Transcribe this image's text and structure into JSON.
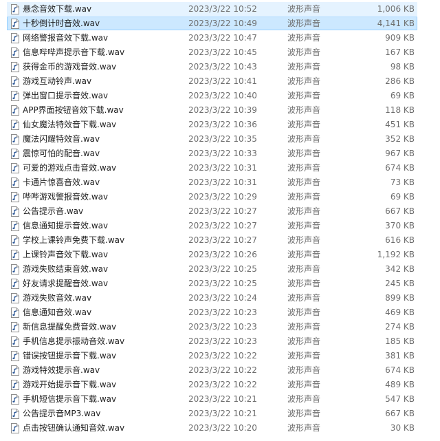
{
  "files": [
    {
      "name": "悬念音效下载.wav",
      "modified": "2023/3/22 10:52",
      "type": "波形声音",
      "size": "1,006 KB",
      "state": "hover"
    },
    {
      "name": "十秒倒计时音效.wav",
      "modified": "2023/3/22 10:49",
      "type": "波形声音",
      "size": "4,141 KB",
      "state": "selected"
    },
    {
      "name": "网络警报音效下载.wav",
      "modified": "2023/3/22 10:47",
      "type": "波形声音",
      "size": "909 KB",
      "state": ""
    },
    {
      "name": "信息哔哔声提示音下载.wav",
      "modified": "2023/3/22 10:45",
      "type": "波形声音",
      "size": "167 KB",
      "state": ""
    },
    {
      "name": "获得金币的游戏音效.wav",
      "modified": "2023/3/22 10:43",
      "type": "波形声音",
      "size": "98 KB",
      "state": ""
    },
    {
      "name": "游戏互动铃声.wav",
      "modified": "2023/3/22 10:41",
      "type": "波形声音",
      "size": "286 KB",
      "state": ""
    },
    {
      "name": "弹出窗口提示音效.wav",
      "modified": "2023/3/22 10:40",
      "type": "波形声音",
      "size": "69 KB",
      "state": ""
    },
    {
      "name": "APP界面按钮音效下载.wav",
      "modified": "2023/3/22 10:39",
      "type": "波形声音",
      "size": "118 KB",
      "state": ""
    },
    {
      "name": "仙女魔法特效音下载.wav",
      "modified": "2023/3/22 10:36",
      "type": "波形声音",
      "size": "451 KB",
      "state": ""
    },
    {
      "name": "魔法闪耀特效音.wav",
      "modified": "2023/3/22 10:35",
      "type": "波形声音",
      "size": "352 KB",
      "state": ""
    },
    {
      "name": "震惊可怕的配音.wav",
      "modified": "2023/3/22 10:33",
      "type": "波形声音",
      "size": "967 KB",
      "state": ""
    },
    {
      "name": "可爱的游戏点击音效.wav",
      "modified": "2023/3/22 10:31",
      "type": "波形声音",
      "size": "674 KB",
      "state": ""
    },
    {
      "name": "卡通片惊喜音效.wav",
      "modified": "2023/3/22 10:31",
      "type": "波形声音",
      "size": "73 KB",
      "state": ""
    },
    {
      "name": "哔哔游戏警报音效.wav",
      "modified": "2023/3/22 10:29",
      "type": "波形声音",
      "size": "69 KB",
      "state": ""
    },
    {
      "name": "公告提示音.wav",
      "modified": "2023/3/22 10:27",
      "type": "波形声音",
      "size": "667 KB",
      "state": ""
    },
    {
      "name": "信息通知提示音效.wav",
      "modified": "2023/3/22 10:27",
      "type": "波形声音",
      "size": "370 KB",
      "state": ""
    },
    {
      "name": "学校上课铃声免费下载.wav",
      "modified": "2023/3/22 10:27",
      "type": "波形声音",
      "size": "616 KB",
      "state": ""
    },
    {
      "name": "上课铃声音效下载.wav",
      "modified": "2023/3/22 10:26",
      "type": "波形声音",
      "size": "1,192 KB",
      "state": ""
    },
    {
      "name": "游戏失败结束音效.wav",
      "modified": "2023/3/22 10:25",
      "type": "波形声音",
      "size": "342 KB",
      "state": ""
    },
    {
      "name": "好友请求提醒音效.wav",
      "modified": "2023/3/22 10:25",
      "type": "波形声音",
      "size": "245 KB",
      "state": ""
    },
    {
      "name": "游戏失败音效.wav",
      "modified": "2023/3/22 10:24",
      "type": "波形声音",
      "size": "899 KB",
      "state": ""
    },
    {
      "name": "信息通知音效.wav",
      "modified": "2023/3/22 10:23",
      "type": "波形声音",
      "size": "469 KB",
      "state": ""
    },
    {
      "name": "新信息提醒免费音效.wav",
      "modified": "2023/3/22 10:23",
      "type": "波形声音",
      "size": "274 KB",
      "state": ""
    },
    {
      "name": "手机信息提示振动音效.wav",
      "modified": "2023/3/22 10:23",
      "type": "波形声音",
      "size": "185 KB",
      "state": ""
    },
    {
      "name": "错误按钮提示音下载.wav",
      "modified": "2023/3/22 10:22",
      "type": "波形声音",
      "size": "381 KB",
      "state": ""
    },
    {
      "name": "游戏特效提示音.wav",
      "modified": "2023/3/22 10:22",
      "type": "波形声音",
      "size": "674 KB",
      "state": ""
    },
    {
      "name": "游戏开始提示音下载.wav",
      "modified": "2023/3/22 10:22",
      "type": "波形声音",
      "size": "489 KB",
      "state": ""
    },
    {
      "name": "手机短信提示音下载.wav",
      "modified": "2023/3/22 10:21",
      "type": "波形声音",
      "size": "547 KB",
      "state": ""
    },
    {
      "name": "公告提示音MP3.wav",
      "modified": "2023/3/22 10:21",
      "type": "波形声音",
      "size": "667 KB",
      "state": ""
    },
    {
      "name": "点击按钮确认通知音效.wav",
      "modified": "2023/3/22 10:20",
      "type": "波形声音",
      "size": "30 KB",
      "state": ""
    }
  ],
  "colors": {
    "selected_bg": "#cce8ff",
    "selected_border": "#99d1ff",
    "hover_bg": "#e5f3ff",
    "icon_note": "#2b5797",
    "secondary_text": "#6d6d6d"
  },
  "icon": "audio-file-icon"
}
